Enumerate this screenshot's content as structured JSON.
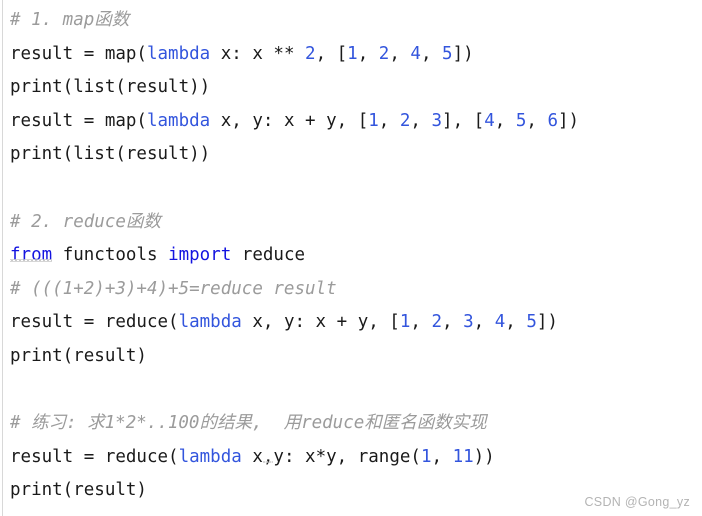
{
  "editor": {
    "background_color": "#ffffff",
    "gutter_rule_color": "#d8d8d8",
    "colors": {
      "text": "#1a1a1a",
      "comment": "#9b9b9b",
      "keyword": "#3355dd",
      "keyword_strong": "#1414e0",
      "number": "#3355dd",
      "squiggle": "#c9c9c9",
      "watermark": "#b4b4b4"
    },
    "language": "python",
    "lines": [
      {
        "index": 1,
        "type": "comment",
        "text": "# 1. map函数"
      },
      {
        "index": 2,
        "type": "code",
        "text": "result = map(lambda x: x ** 2, [1, 2, 4, 5])"
      },
      {
        "index": 3,
        "type": "code",
        "text": "print(list(result))"
      },
      {
        "index": 4,
        "type": "code",
        "text": "result = map(lambda x, y: x + y, [1, 2, 3], [4, 5, 6])"
      },
      {
        "index": 5,
        "type": "code",
        "text": "print(list(result))"
      },
      {
        "index": 6,
        "type": "blank",
        "text": ""
      },
      {
        "index": 7,
        "type": "comment",
        "text": "# 2. reduce函数"
      },
      {
        "index": 8,
        "type": "code",
        "text": "from functools import reduce"
      },
      {
        "index": 9,
        "type": "comment",
        "text": "# (((1+2)+3)+4)+5=reduce result"
      },
      {
        "index": 10,
        "type": "code",
        "text": "result = reduce(lambda x, y: x + y, [1, 2, 3, 4, 5])"
      },
      {
        "index": 11,
        "type": "code",
        "text": "print(result)"
      },
      {
        "index": 12,
        "type": "blank",
        "text": ""
      },
      {
        "index": 13,
        "type": "comment",
        "text": "# 练习: 求1*2*..100的结果,  用reduce和匿名函数实现"
      },
      {
        "index": 14,
        "type": "code",
        "text": "result = reduce(lambda x,y: x*y, range(1, 11))"
      },
      {
        "index": 15,
        "type": "code",
        "text": "print(result)"
      }
    ],
    "tokens": {
      "l1_comment": "# 1. map函数",
      "l2_a": "result = map(",
      "l2_lambda": "lambda",
      "l2_b": " x: x ** ",
      "l2_n1": "2",
      "l2_c": ", [",
      "l2_n2": "1",
      "l2_d": ", ",
      "l2_n3": "2",
      "l2_e": ", ",
      "l2_n4": "4",
      "l2_f": ", ",
      "l2_n5": "5",
      "l2_g": "])",
      "l3": "print(list(result))",
      "l4_a": "result = map(",
      "l4_lambda": "lambda",
      "l4_b": " x, y: x + y, [",
      "l4_n1": "1",
      "l4_c": ", ",
      "l4_n2": "2",
      "l4_d": ", ",
      "l4_n3": "3",
      "l4_e": "], [",
      "l4_n4": "4",
      "l4_f": ", ",
      "l4_n5": "5",
      "l4_g": ", ",
      "l4_n6": "6",
      "l4_h": "])",
      "l5": "print(list(result))",
      "l7_comment": "# 2. reduce函数",
      "l8_from": "from",
      "l8_mid": " functools ",
      "l8_import": "import",
      "l8_end": " reduce",
      "l9_comment": "# (((1+2)+3)+4)+5=reduce result",
      "l10_a": "result = reduce(",
      "l10_lambda": "lambda",
      "l10_b": " x, y: x + y, [",
      "l10_n1": "1",
      "l10_c": ", ",
      "l10_n2": "2",
      "l10_d": ", ",
      "l10_n3": "3",
      "l10_e": ", ",
      "l10_n4": "4",
      "l10_f": ", ",
      "l10_n5": "5",
      "l10_g": "])",
      "l11": "print(result)",
      "l13_comment": "# 练习: 求1*2*..100的结果,  用reduce和匿名函数实现",
      "l14_a": "result = reduce(",
      "l14_lambda": "lambda",
      "l14_b": " x",
      "l14_comma": ",",
      "l14_c": "y: x*y, range(",
      "l14_n1": "1",
      "l14_d": ", ",
      "l14_n2": "11",
      "l14_e": "))",
      "l15": "print(result)"
    }
  },
  "watermark": {
    "text": "CSDN @Gong_yz"
  }
}
